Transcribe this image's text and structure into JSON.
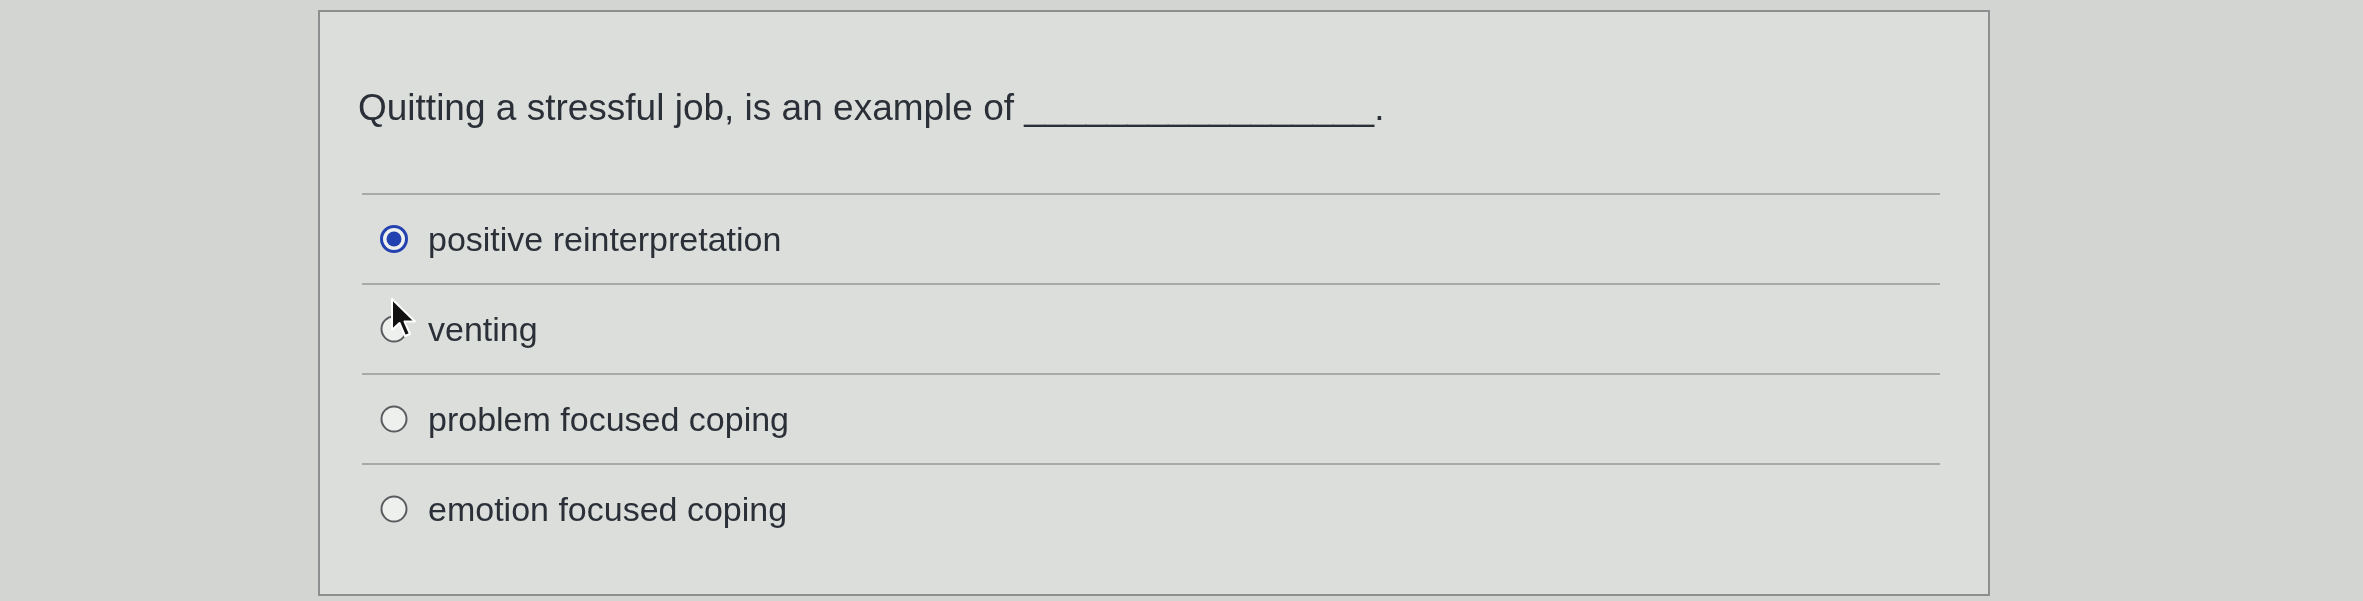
{
  "question": {
    "text": "Quitting a stressful job, is an example of _________________."
  },
  "options": [
    {
      "label": "positive reinterpretation",
      "selected": true
    },
    {
      "label": "venting",
      "selected": false
    },
    {
      "label": "problem focused coping",
      "selected": false
    },
    {
      "label": "emotion focused coping",
      "selected": false
    }
  ]
}
